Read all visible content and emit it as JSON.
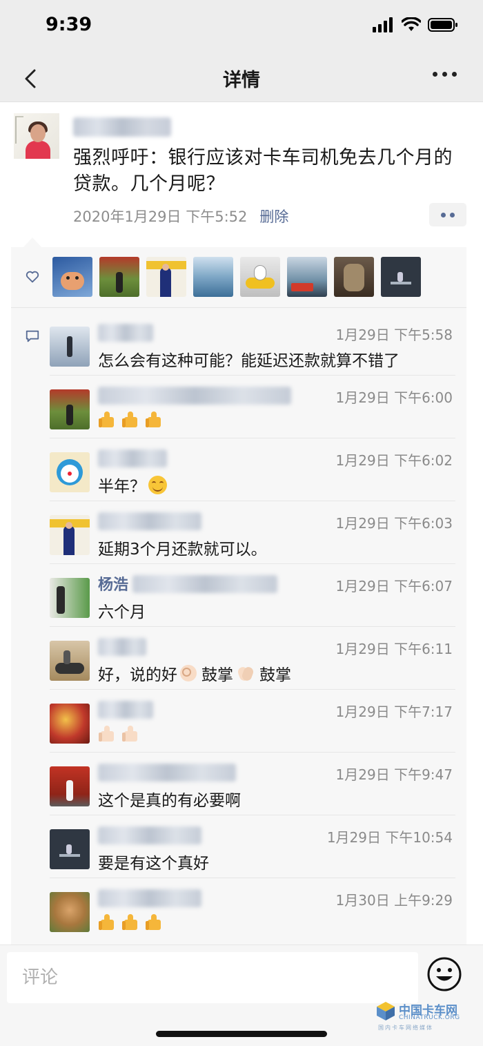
{
  "status_bar": {
    "time": "9:39"
  },
  "nav": {
    "title": "详情"
  },
  "post": {
    "text": "强烈呼吁：银行应该对卡车司机免去几个月的贷款。几个月呢？",
    "date": "2020年1月29日",
    "time": "下午5:52",
    "delete_label": "删除"
  },
  "comments": [
    {
      "time": "1月29日 下午5:58",
      "text": "怎么会有这种可能？能延迟还款就算不错了"
    },
    {
      "time": "1月29日 下午6:00",
      "text": ""
    },
    {
      "time": "1月29日 下午6:02",
      "text": "半年？"
    },
    {
      "time": "1月29日 下午6:03",
      "text": "延期3个月还款就可以。"
    },
    {
      "time": "1月29日 下午6:07",
      "name_visible": "杨浩",
      "text": "六个月"
    },
    {
      "time": "1月29日 下午6:11",
      "text_parts": [
        "好，说的好",
        "鼓掌",
        "鼓掌"
      ]
    },
    {
      "time": "1月29日 下午7:17",
      "text": ""
    },
    {
      "time": "1月29日 下午9:47",
      "text": "这个是真的有必要啊"
    },
    {
      "time": "1月29日 下午10:54",
      "text": "要是有这个真好"
    },
    {
      "time": "1月30日 上午9:29",
      "text": ""
    }
  ],
  "input": {
    "placeholder": "评论"
  },
  "watermark": {
    "name": "中国卡车网",
    "sub": "CHINATRUCK.ORG",
    "slogan": "国内卡车网络媒体"
  },
  "colors": {
    "link": "#576b95",
    "bg": "#ededed",
    "card": "#f7f7f7"
  }
}
